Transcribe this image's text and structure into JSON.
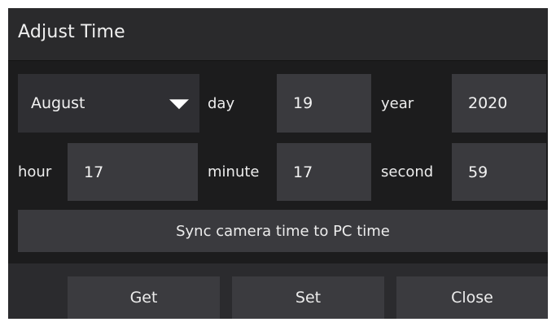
{
  "dialog": {
    "title": "Adjust Time"
  },
  "date": {
    "month_selected": "August",
    "day_label": "day",
    "day_value": "19",
    "year_label": "year",
    "year_value": "2020"
  },
  "time": {
    "hour_label": "hour",
    "hour_value": "17",
    "minute_label": "minute",
    "minute_value": "17",
    "second_label": "second",
    "second_value": "59"
  },
  "sync_button": "Sync camera time to PC time",
  "footer": {
    "get_label": "Get",
    "set_label": "Set",
    "close_label": "Close"
  },
  "icons": {
    "dropdown": "chevron-down-icon"
  },
  "colors": {
    "dialog_bg": "#1c1c1d",
    "title_bg": "#2a2a2c",
    "field_bg": "#3a3a3e",
    "text": "#e8e8e8"
  }
}
